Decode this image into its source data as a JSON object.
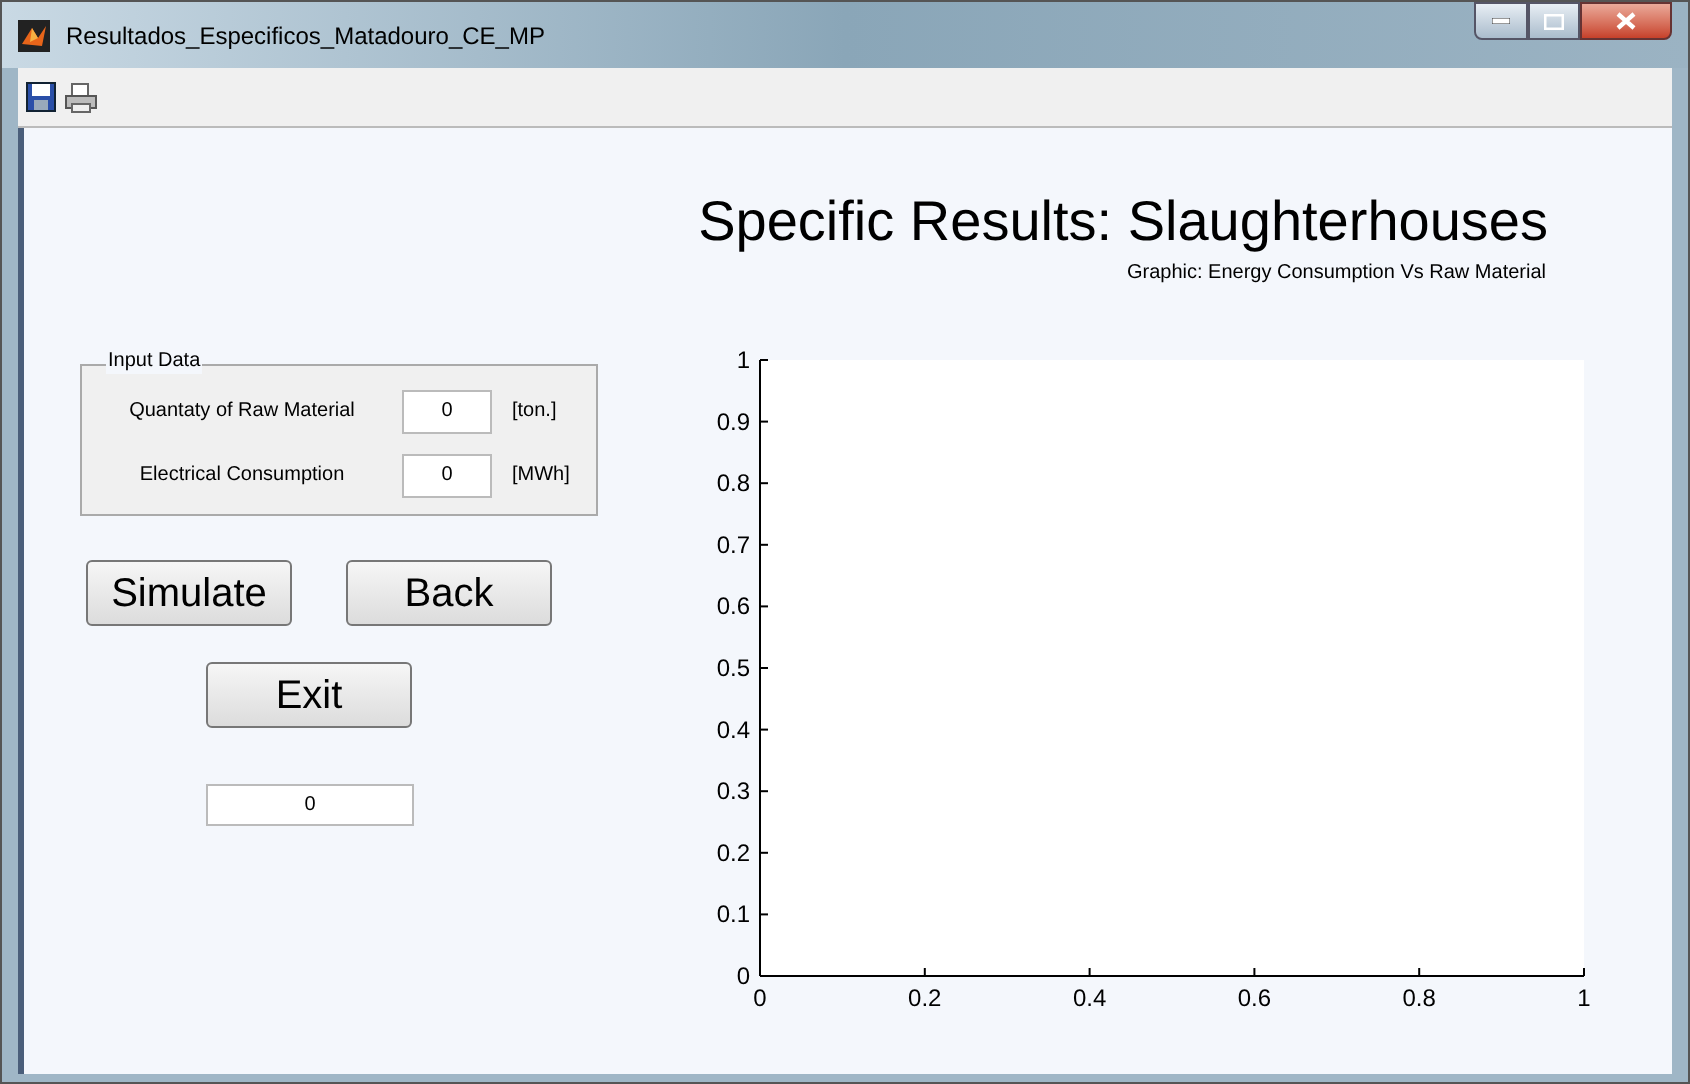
{
  "window": {
    "title": "Resultados_Especificos_Matadouro_CE_MP"
  },
  "toolbar": [
    {
      "kind": "save"
    },
    {
      "kind": "print"
    }
  ],
  "header": {
    "title": "Specific Results: Slaughterhouses",
    "subtitle": "Graphic: Energy Consumption Vs Raw Material"
  },
  "input_panel": {
    "title": "Input Data",
    "fields": [
      {
        "label": "Quantaty of Raw Material",
        "value": "0",
        "unit": "[ton.]"
      },
      {
        "label": "Electrical Consumption",
        "value": "0",
        "unit": "[MWh]"
      }
    ]
  },
  "buttons": {
    "simulate": "Simulate",
    "back": "Back",
    "exit": "Exit"
  },
  "output_field": {
    "value": "0"
  },
  "chart": {
    "chart_data": {
      "type": "line",
      "xlim": [
        0,
        1
      ],
      "ylim": [
        0,
        1
      ],
      "xticks": [
        {
          "value": 0,
          "label": "0"
        },
        {
          "value": 0.2,
          "label": "0.2"
        },
        {
          "value": 0.4,
          "label": "0.4"
        },
        {
          "value": 0.6,
          "label": "0.6"
        },
        {
          "value": 0.8,
          "label": "0.8"
        },
        {
          "value": 1,
          "label": "1"
        }
      ],
      "yticks": [
        {
          "value": 0,
          "label": "0"
        },
        {
          "value": 0.1,
          "label": "0.1"
        },
        {
          "value": 0.2,
          "label": "0.2"
        },
        {
          "value": 0.3,
          "label": "0.3"
        },
        {
          "value": 0.4,
          "label": "0.4"
        },
        {
          "value": 0.5,
          "label": "0.5"
        },
        {
          "value": 0.6,
          "label": "0.6"
        },
        {
          "value": 0.7,
          "label": "0.7"
        },
        {
          "value": 0.8,
          "label": "0.8"
        },
        {
          "value": 0.9,
          "label": "0.9"
        },
        {
          "value": 1,
          "label": "1"
        }
      ]
    }
  }
}
